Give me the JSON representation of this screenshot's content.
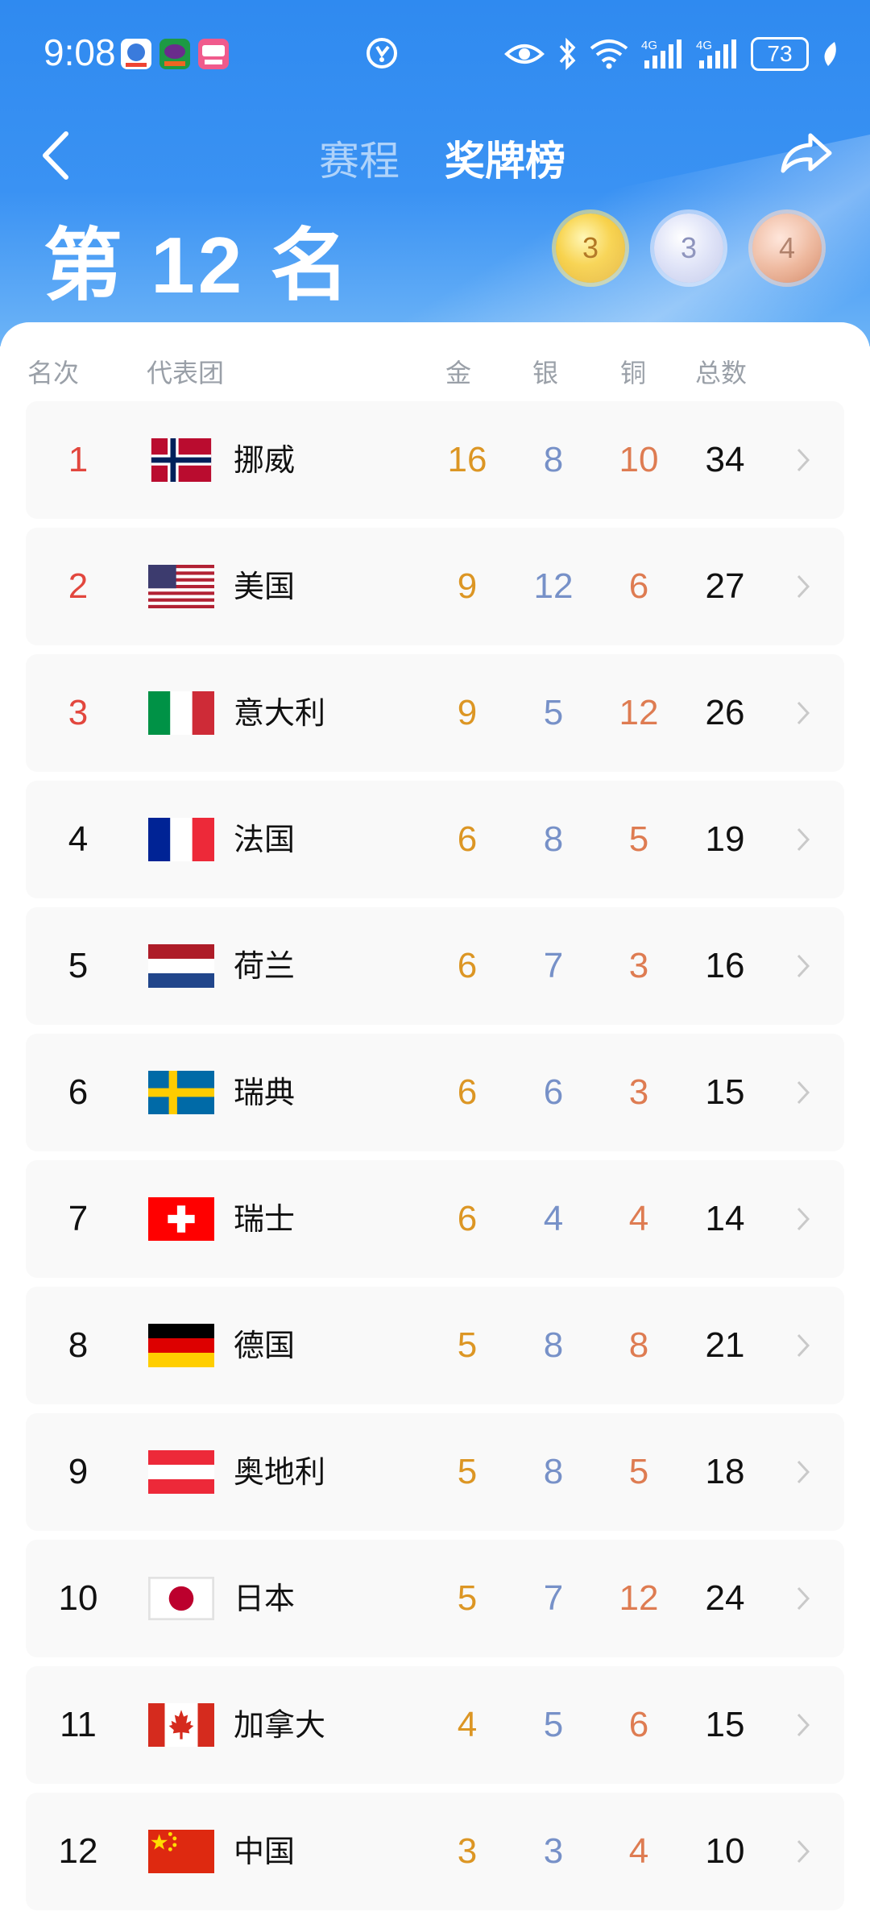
{
  "status_bar": {
    "time": "9:08",
    "battery": "73",
    "network": "4G"
  },
  "nav": {
    "tab_schedule": "赛程",
    "tab_medals": "奖牌榜"
  },
  "summary": {
    "rank_title": "第 12 名",
    "gold": "3",
    "silver": "3",
    "bronze": "4"
  },
  "table": {
    "headers": {
      "rank": "名次",
      "delegation": "代表团",
      "gold": "金",
      "silver": "银",
      "bronze": "铜",
      "total": "总数"
    },
    "rows": [
      {
        "rank": "1",
        "country": "挪威",
        "flag": "norway-flag-icon",
        "gold": "16",
        "silver": "8",
        "bronze": "10",
        "total": "34"
      },
      {
        "rank": "2",
        "country": "美国",
        "flag": "usa-flag-icon",
        "gold": "9",
        "silver": "12",
        "bronze": "6",
        "total": "27"
      },
      {
        "rank": "3",
        "country": "意大利",
        "flag": "italy-flag-icon",
        "gold": "9",
        "silver": "5",
        "bronze": "12",
        "total": "26"
      },
      {
        "rank": "4",
        "country": "法国",
        "flag": "france-flag-icon",
        "gold": "6",
        "silver": "8",
        "bronze": "5",
        "total": "19"
      },
      {
        "rank": "5",
        "country": "荷兰",
        "flag": "netherlands-flag-icon",
        "gold": "6",
        "silver": "7",
        "bronze": "3",
        "total": "16"
      },
      {
        "rank": "6",
        "country": "瑞典",
        "flag": "sweden-flag-icon",
        "gold": "6",
        "silver": "6",
        "bronze": "3",
        "total": "15"
      },
      {
        "rank": "7",
        "country": "瑞士",
        "flag": "switzerland-flag-icon",
        "gold": "6",
        "silver": "4",
        "bronze": "4",
        "total": "14"
      },
      {
        "rank": "8",
        "country": "德国",
        "flag": "germany-flag-icon",
        "gold": "5",
        "silver": "8",
        "bronze": "8",
        "total": "21"
      },
      {
        "rank": "9",
        "country": "奥地利",
        "flag": "austria-flag-icon",
        "gold": "5",
        "silver": "8",
        "bronze": "5",
        "total": "18"
      },
      {
        "rank": "10",
        "country": "日本",
        "flag": "japan-flag-icon",
        "gold": "5",
        "silver": "7",
        "bronze": "12",
        "total": "24"
      },
      {
        "rank": "11",
        "country": "加拿大",
        "flag": "canada-flag-icon",
        "gold": "4",
        "silver": "5",
        "bronze": "6",
        "total": "15"
      },
      {
        "rank": "12",
        "country": "中国",
        "flag": "china-flag-icon",
        "gold": "3",
        "silver": "3",
        "bronze": "4",
        "total": "10"
      }
    ]
  },
  "colors": {
    "gold": "#dc9624",
    "silver": "#7791c8",
    "bronze": "#de7c52",
    "top_rank": "#e2473e",
    "header_blue": "#3a92f3"
  }
}
